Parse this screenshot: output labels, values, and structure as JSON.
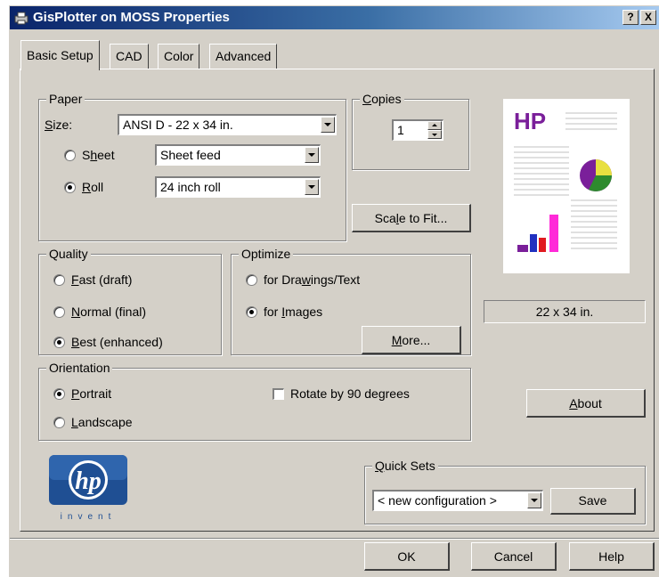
{
  "window": {
    "title": "GisPlotter on MOSS Properties",
    "help_btn": "?",
    "close_btn": "X"
  },
  "tabs": [
    {
      "label": "Basic Setup"
    },
    {
      "label": "CAD"
    },
    {
      "label": "Color"
    },
    {
      "label": "Advanced"
    }
  ],
  "paper": {
    "label": "Paper",
    "size_label": "Size:",
    "size_value": "ANSI D - 22 x 34 in.",
    "sheet_label": "Sheet",
    "sheet_value": "Sheet feed",
    "roll_label": "Roll",
    "roll_value": "24 inch roll",
    "selected": "roll"
  },
  "copies": {
    "label": "Copies",
    "value": "1"
  },
  "scale_button": "Scale to Fit...",
  "quality": {
    "label": "Quality",
    "options": [
      "Fast (draft)",
      "Normal (final)",
      "Best (enhanced)"
    ],
    "selected": 2
  },
  "optimize": {
    "label": "Optimize",
    "options": [
      "for Drawings/Text",
      "for Images"
    ],
    "selected": 1,
    "more_button": "More..."
  },
  "orientation": {
    "label": "Orientation",
    "portrait": "Portrait",
    "landscape": "Landscape",
    "selected": "portrait",
    "rotate_label": "Rotate by 90 degrees",
    "rotate_checked": false
  },
  "preview": {
    "brand": "HP",
    "size_text": "22 x 34 in."
  },
  "about_button": "About",
  "logo": {
    "mark": "hp",
    "tagline": "invent"
  },
  "quick_sets": {
    "label": "Quick Sets",
    "value": "< new configuration >",
    "save_button": "Save"
  },
  "footer": {
    "ok": "OK",
    "cancel": "Cancel",
    "help": "Help"
  },
  "colors": {
    "title_start": "#0a246a",
    "title_end": "#a6caf0",
    "face": "#d4d0c8",
    "hp_brand": "#7a1f9a",
    "logo_blue": "#1f4f93"
  }
}
